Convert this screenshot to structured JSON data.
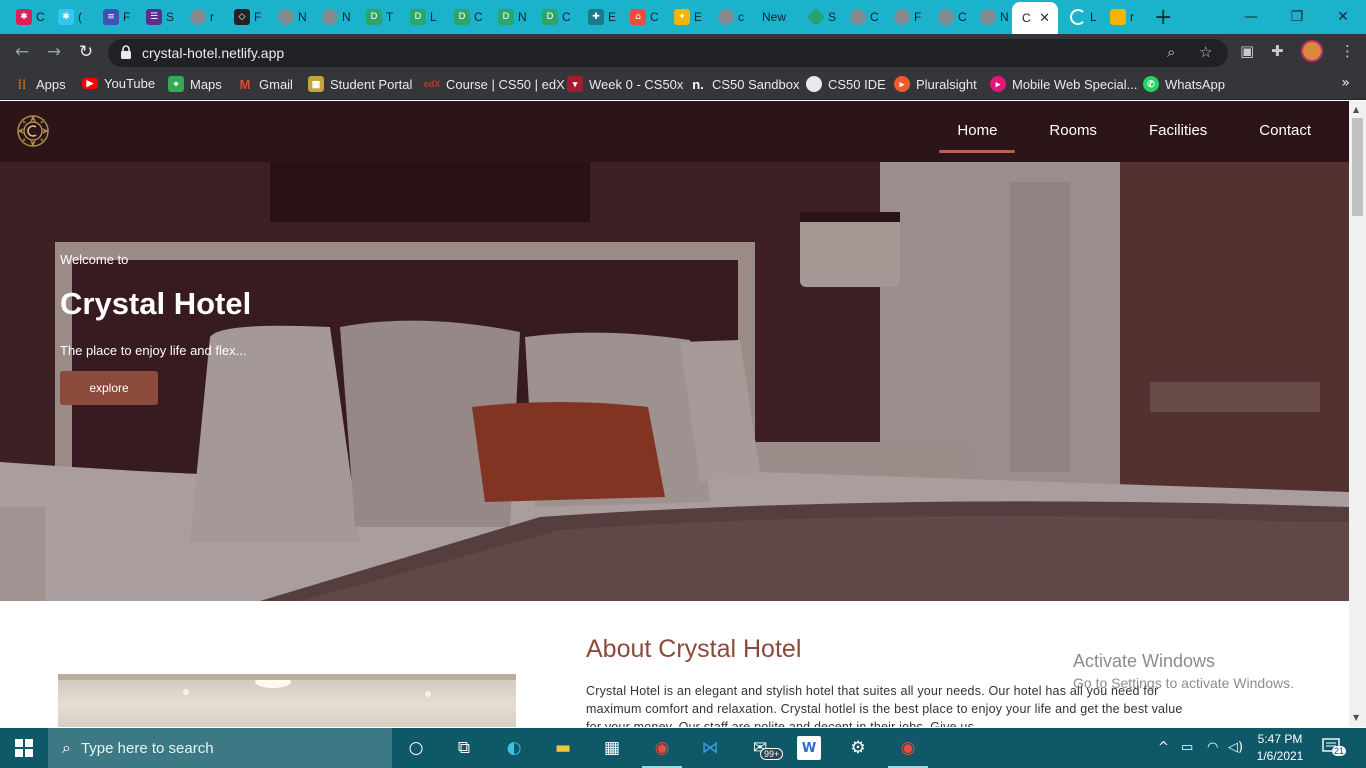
{
  "browser": {
    "tabs": [
      {
        "label": "C",
        "icon": "slack-icon",
        "color": "#e01e5a"
      },
      {
        "label": "(",
        "icon": "slack-icon",
        "color": "#36c5f0"
      },
      {
        "label": "F",
        "icon": "google-forms-icon",
        "color": "#3f51b5"
      },
      {
        "label": "S",
        "icon": "form-icon",
        "color": "#5b2d8e"
      },
      {
        "label": "r",
        "icon": "globe-icon",
        "color": "#7f8b8e"
      },
      {
        "label": "F",
        "icon": "codepen-icon",
        "color": "#222222"
      },
      {
        "label": "N",
        "icon": "globe-icon",
        "color": "#7f8b8e"
      },
      {
        "label": "N",
        "icon": "globe-icon",
        "color": "#7f8b8e"
      },
      {
        "label": "T",
        "icon": "d-icon",
        "color": "#2fa56b"
      },
      {
        "label": "L",
        "icon": "d-icon",
        "color": "#2fa56b"
      },
      {
        "label": "C",
        "icon": "d-icon",
        "color": "#2fa56b"
      },
      {
        "label": "N",
        "icon": "d-icon",
        "color": "#2fa56b"
      },
      {
        "label": "C",
        "icon": "d-icon",
        "color": "#2fa56b"
      },
      {
        "label": "E",
        "icon": "extension-icon",
        "color": "#1b7a8a"
      },
      {
        "label": "C",
        "icon": "store-icon",
        "color": "#e84c3d"
      },
      {
        "label": "E",
        "icon": "pinwheel-icon",
        "color": "#f4b400"
      },
      {
        "label": "c",
        "icon": "globe-icon",
        "color": "#7f8b8e"
      },
      {
        "label": "New",
        "icon": "none",
        "color": "#1bb3cc"
      },
      {
        "label": "S",
        "icon": "diamond-icon",
        "color": "#25a36f"
      },
      {
        "label": "C",
        "icon": "globe-icon",
        "color": "#7f8b8e"
      },
      {
        "label": "F",
        "icon": "globe-icon",
        "color": "#7f8b8e"
      },
      {
        "label": "C",
        "icon": "globe-icon",
        "color": "#7f8b8e"
      },
      {
        "label": "N",
        "icon": "globe-icon",
        "color": "#7f8b8e"
      },
      {
        "label": "C",
        "icon": "active",
        "color": "#ffffff"
      },
      {
        "label": "L",
        "icon": "loading-icon",
        "color": "#ffffff"
      },
      {
        "label": "r",
        "icon": "slides-icon",
        "color": "#f4b400"
      }
    ],
    "url": "crystal-hotel.netlify.app",
    "bookmarks": [
      {
        "label": "Apps",
        "icon": "apps-grid-icon",
        "color": "#e8710a"
      },
      {
        "label": "YouTube",
        "icon": "youtube-icon",
        "color": "#ff0000"
      },
      {
        "label": "Maps",
        "icon": "maps-icon",
        "color": "#34a853"
      },
      {
        "label": "Gmail",
        "icon": "gmail-icon",
        "color": "#ea4335"
      },
      {
        "label": "Student Portal",
        "icon": "portal-icon",
        "color": "#c7a43a"
      },
      {
        "label": "Course | CS50 | edX",
        "icon": "edx-icon",
        "color": "#c0392b"
      },
      {
        "label": "Week 0 - CS50x",
        "icon": "harvard-icon",
        "color": "#a51c30"
      },
      {
        "label": "CS50 Sandbox",
        "icon": "n-icon",
        "color": "#35363a"
      },
      {
        "label": "CS50 IDE",
        "icon": "globe-icon",
        "color": "#5f6368"
      },
      {
        "label": "Pluralsight",
        "icon": "pluralsight-icon",
        "color": "#f15b2a"
      },
      {
        "label": "Mobile Web Special...",
        "icon": "pluralsight-icon",
        "color": "#e5157a"
      },
      {
        "label": "WhatsApp",
        "icon": "whatsapp-icon",
        "color": "#25d366"
      }
    ]
  },
  "site": {
    "nav": [
      "Home",
      "Rooms",
      "Facilities",
      "Contact"
    ],
    "hero": {
      "welcome": "Welcome to",
      "title": "Crystal Hotel",
      "tagline": "The place to enjoy life and flex...",
      "button": "explore"
    },
    "about": {
      "title": "About Crystal Hotel",
      "text": "Crystal Hotel is an elegant and stylish hotel that suites all your needs. Our hotel has all you need for maximum comfort and relaxation. Crystal hotlel is the best place to enjoy your life and get the best value for your money. Our staff are polite and decent in their jobs. Give us"
    }
  },
  "watermark": {
    "line1": "Activate Windows",
    "line2": "Go to Settings to activate Windows."
  },
  "taskbar": {
    "search_placeholder": "Type here to search",
    "mail_badge": "99+",
    "time": "5:47 PM",
    "date": "1/6/2021",
    "notifications": "21"
  },
  "colors": {
    "accent": "#8c4a3d",
    "nav_bg": "#2b1519",
    "chrome_tabstrip": "#1bb3cc",
    "taskbar": "#0e5868"
  }
}
